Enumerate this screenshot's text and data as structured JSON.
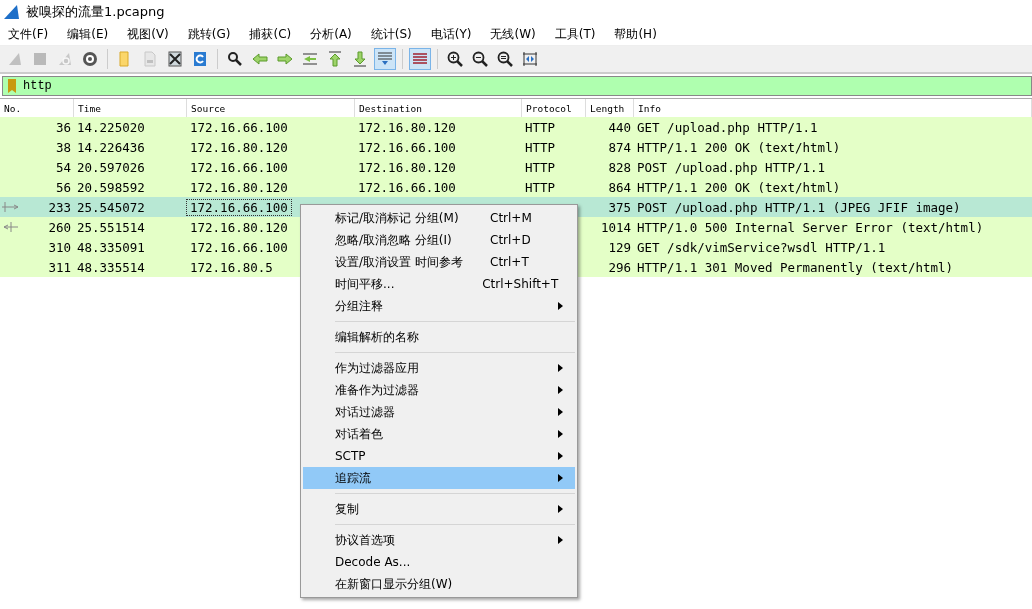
{
  "window": {
    "title": "被嗅探的流量1.pcapng"
  },
  "menu_bar": [
    "文件(F)",
    "编辑(E)",
    "视图(V)",
    "跳转(G)",
    "捕获(C)",
    "分析(A)",
    "统计(S)",
    "电话(Y)",
    "无线(W)",
    "工具(T)",
    "帮助(H)"
  ],
  "toolbar": [
    {
      "kind": "fin",
      "disabled": true,
      "active": false
    },
    {
      "kind": "stop",
      "disabled": true,
      "active": false
    },
    {
      "kind": "restart",
      "disabled": true,
      "active": false
    },
    {
      "kind": "gear",
      "disabled": false,
      "active": false
    },
    {
      "kind": "separator"
    },
    {
      "kind": "folder",
      "disabled": false,
      "active": false
    },
    {
      "kind": "save",
      "disabled": true,
      "active": false
    },
    {
      "kind": "close",
      "disabled": false,
      "active": false
    },
    {
      "kind": "reload",
      "disabled": false,
      "active": false
    },
    {
      "kind": "separator"
    },
    {
      "kind": "search",
      "disabled": false,
      "active": false
    },
    {
      "kind": "left",
      "disabled": false,
      "active": false
    },
    {
      "kind": "right",
      "disabled": false,
      "active": false
    },
    {
      "kind": "goto",
      "disabled": false,
      "active": false
    },
    {
      "kind": "up",
      "disabled": false,
      "active": false
    },
    {
      "kind": "down",
      "disabled": false,
      "active": false
    },
    {
      "kind": "scroll",
      "disabled": false,
      "active": true
    },
    {
      "kind": "separator"
    },
    {
      "kind": "lines",
      "disabled": false,
      "active": true
    },
    {
      "kind": "separator"
    },
    {
      "kind": "zoom_in",
      "disabled": false,
      "active": false
    },
    {
      "kind": "zoom_out",
      "disabled": false,
      "active": false
    },
    {
      "kind": "zoom_reset",
      "disabled": false,
      "active": false
    },
    {
      "kind": "columns",
      "disabled": false,
      "active": false
    }
  ],
  "filter": {
    "value": "http"
  },
  "table": {
    "columns": [
      "No.",
      "Time",
      "Source",
      "Destination",
      "Protocol",
      "Length",
      "Info"
    ],
    "rows": [
      {
        "no": "36",
        "time": "14.225020",
        "source": "172.16.66.100",
        "destination": "172.16.80.120",
        "protocol": "HTTP",
        "length": "440",
        "info": "GET /upload.php HTTP/1.1",
        "selected": false,
        "request": false,
        "response": false
      },
      {
        "no": "38",
        "time": "14.226436",
        "source": "172.16.80.120",
        "destination": "172.16.66.100",
        "protocol": "HTTP",
        "length": "874",
        "info": "HTTP/1.1 200 OK  (text/html)",
        "selected": false,
        "request": false,
        "response": false
      },
      {
        "no": "54",
        "time": "20.597026",
        "source": "172.16.66.100",
        "destination": "172.16.80.120",
        "protocol": "HTTP",
        "length": "828",
        "info": "POST /upload.php HTTP/1.1",
        "selected": false,
        "request": false,
        "response": false
      },
      {
        "no": "56",
        "time": "20.598592",
        "source": "172.16.80.120",
        "destination": "172.16.66.100",
        "protocol": "HTTP",
        "length": "864",
        "info": "HTTP/1.1 200 OK  (text/html)",
        "selected": false,
        "request": false,
        "response": false
      },
      {
        "no": "233",
        "time": "25.545072",
        "source": "172.16.66.100",
        "length": "375",
        "info": "POST /upload.php HTTP/1.1  (JPEG JFIF image)",
        "selected": true,
        "request": true,
        "response": false
      },
      {
        "no": "260",
        "time": "25.551514",
        "source": "172.16.80.120",
        "length": "1014",
        "info": "HTTP/1.0 500 Internal Server Error  (text/html)",
        "selected": false,
        "request": false,
        "response": true
      },
      {
        "no": "310",
        "time": "48.335091",
        "source": "172.16.66.100",
        "length": "129",
        "info": "GET /sdk/vimService?wsdl HTTP/1.1",
        "selected": false,
        "request": false,
        "response": false
      },
      {
        "no": "311",
        "time": "48.335514",
        "source": "172.16.80.5",
        "length": "296",
        "info": "HTTP/1.1 301 Moved Permanently  (text/html)",
        "selected": false,
        "request": false,
        "response": false
      }
    ]
  },
  "context_menu": [
    {
      "kind": "item",
      "label": "标记/取消标记 分组(M)",
      "shortcut": "Ctrl+M",
      "submenu": false,
      "selected": false
    },
    {
      "kind": "item",
      "label": "忽略/取消忽略 分组(I)",
      "shortcut": "Ctrl+D",
      "submenu": false,
      "selected": false
    },
    {
      "kind": "item",
      "label": "设置/取消设置 时间参考",
      "shortcut": "Ctrl+T",
      "submenu": false,
      "selected": false
    },
    {
      "kind": "item",
      "label": "时间平移...",
      "shortcut": "Ctrl+Shift+T",
      "submenu": false,
      "selected": false
    },
    {
      "kind": "item",
      "label": "分组注释",
      "submenu": true,
      "selected": false
    },
    {
      "kind": "separator"
    },
    {
      "kind": "item",
      "label": "编辑解析的名称",
      "submenu": false,
      "selected": false
    },
    {
      "kind": "separator"
    },
    {
      "kind": "item",
      "label": "作为过滤器应用",
      "submenu": true,
      "selected": false
    },
    {
      "kind": "item",
      "label": "准备作为过滤器",
      "submenu": true,
      "selected": false
    },
    {
      "kind": "item",
      "label": "对话过滤器",
      "submenu": true,
      "selected": false
    },
    {
      "kind": "item",
      "label": "对话着色",
      "submenu": true,
      "selected": false
    },
    {
      "kind": "item",
      "label": "SCTP",
      "submenu": true,
      "selected": false
    },
    {
      "kind": "item",
      "label": "追踪流",
      "submenu": true,
      "selected": true
    },
    {
      "kind": "separator"
    },
    {
      "kind": "item",
      "label": "复制",
      "submenu": true,
      "selected": false
    },
    {
      "kind": "separator"
    },
    {
      "kind": "item",
      "label": "协议首选项",
      "submenu": true,
      "selected": false
    },
    {
      "kind": "item",
      "label": "Decode As...",
      "submenu": false,
      "selected": false
    },
    {
      "kind": "item",
      "label": "在新窗口显示分组(W)",
      "submenu": false,
      "selected": false
    }
  ]
}
